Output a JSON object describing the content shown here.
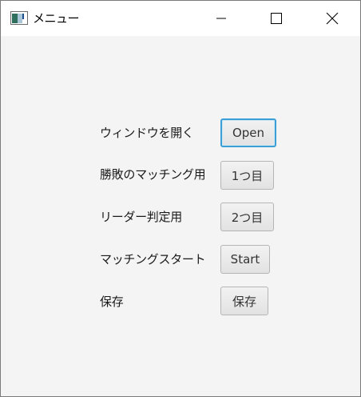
{
  "window": {
    "title": "メニュー"
  },
  "menu": {
    "rows": [
      {
        "label": "ウィンドウを開く",
        "button": "Open"
      },
      {
        "label": "勝敗のマッチング用",
        "button": "1つ目"
      },
      {
        "label": "リーダー判定用",
        "button": "2つ目"
      },
      {
        "label": "マッチングスタート",
        "button": "Start"
      },
      {
        "label": "保存",
        "button": "保存"
      }
    ]
  },
  "colors": {
    "window_bg": "#f4f4f4",
    "titlebar_bg": "#ffffff",
    "focus_ring": "#3b9fd6"
  }
}
